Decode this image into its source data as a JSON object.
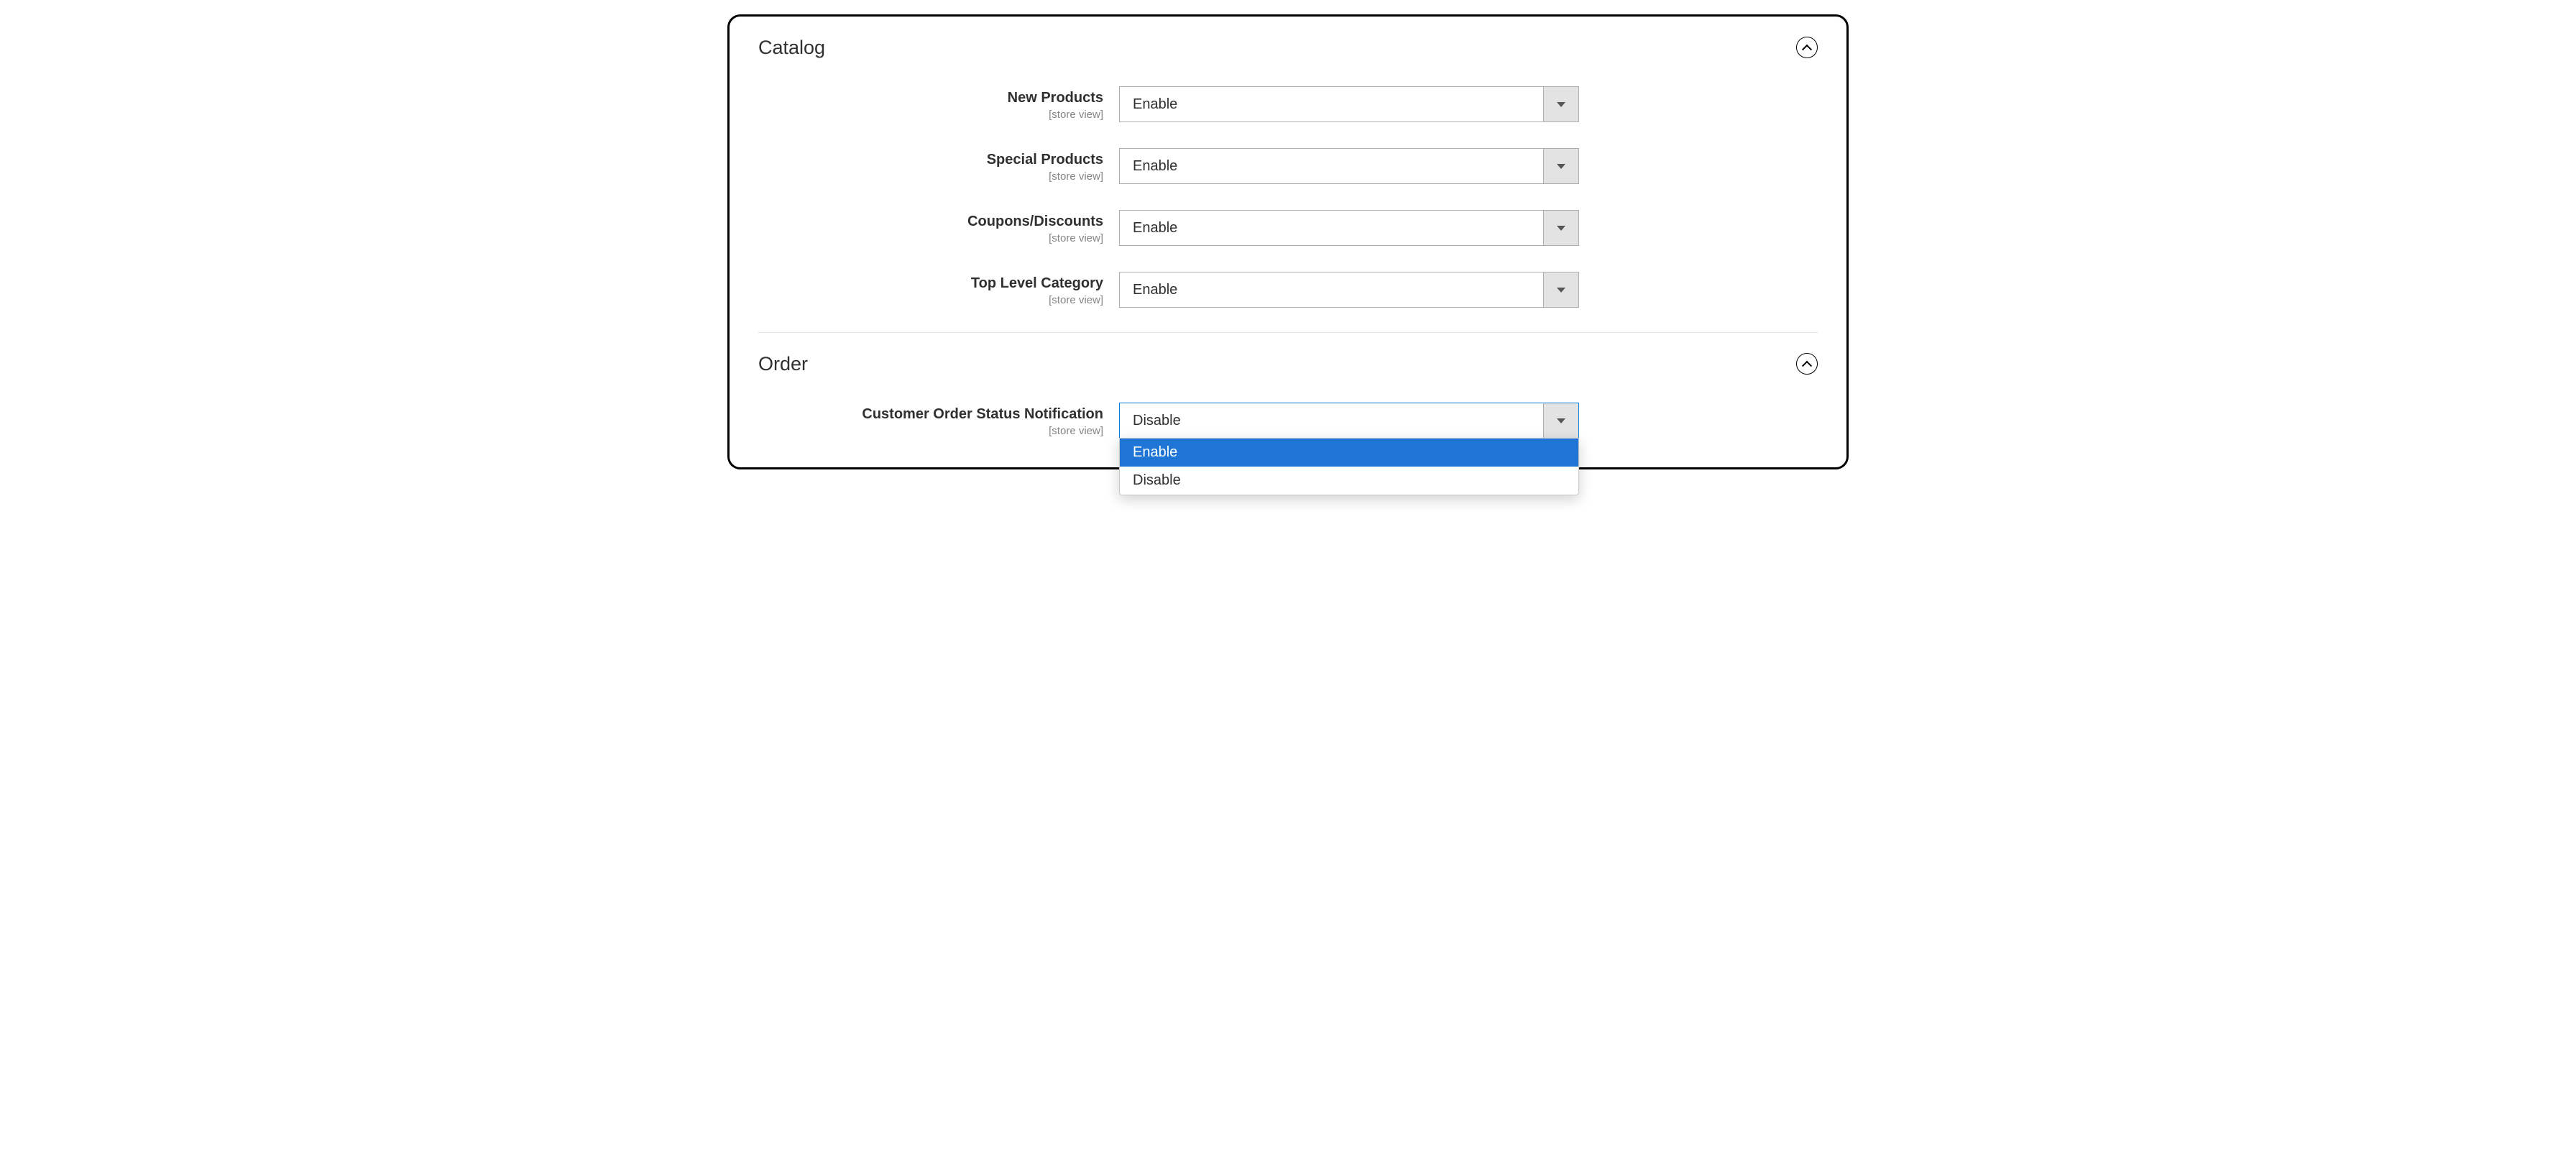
{
  "sections": {
    "catalog": {
      "title": "Catalog",
      "rows": [
        {
          "label": "New Products",
          "scope": "[store view]",
          "value": "Enable"
        },
        {
          "label": "Special Products",
          "scope": "[store view]",
          "value": "Enable"
        },
        {
          "label": "Coupons/Discounts",
          "scope": "[store view]",
          "value": "Enable"
        },
        {
          "label": "Top Level Category",
          "scope": "[store view]",
          "value": "Enable"
        }
      ]
    },
    "order": {
      "title": "Order",
      "rows": [
        {
          "label": "Customer Order Status Notification",
          "scope": "[store view]",
          "value": "Disable"
        }
      ],
      "open_dropdown": {
        "options": [
          "Enable",
          "Disable"
        ],
        "highlighted": "Enable"
      }
    }
  }
}
